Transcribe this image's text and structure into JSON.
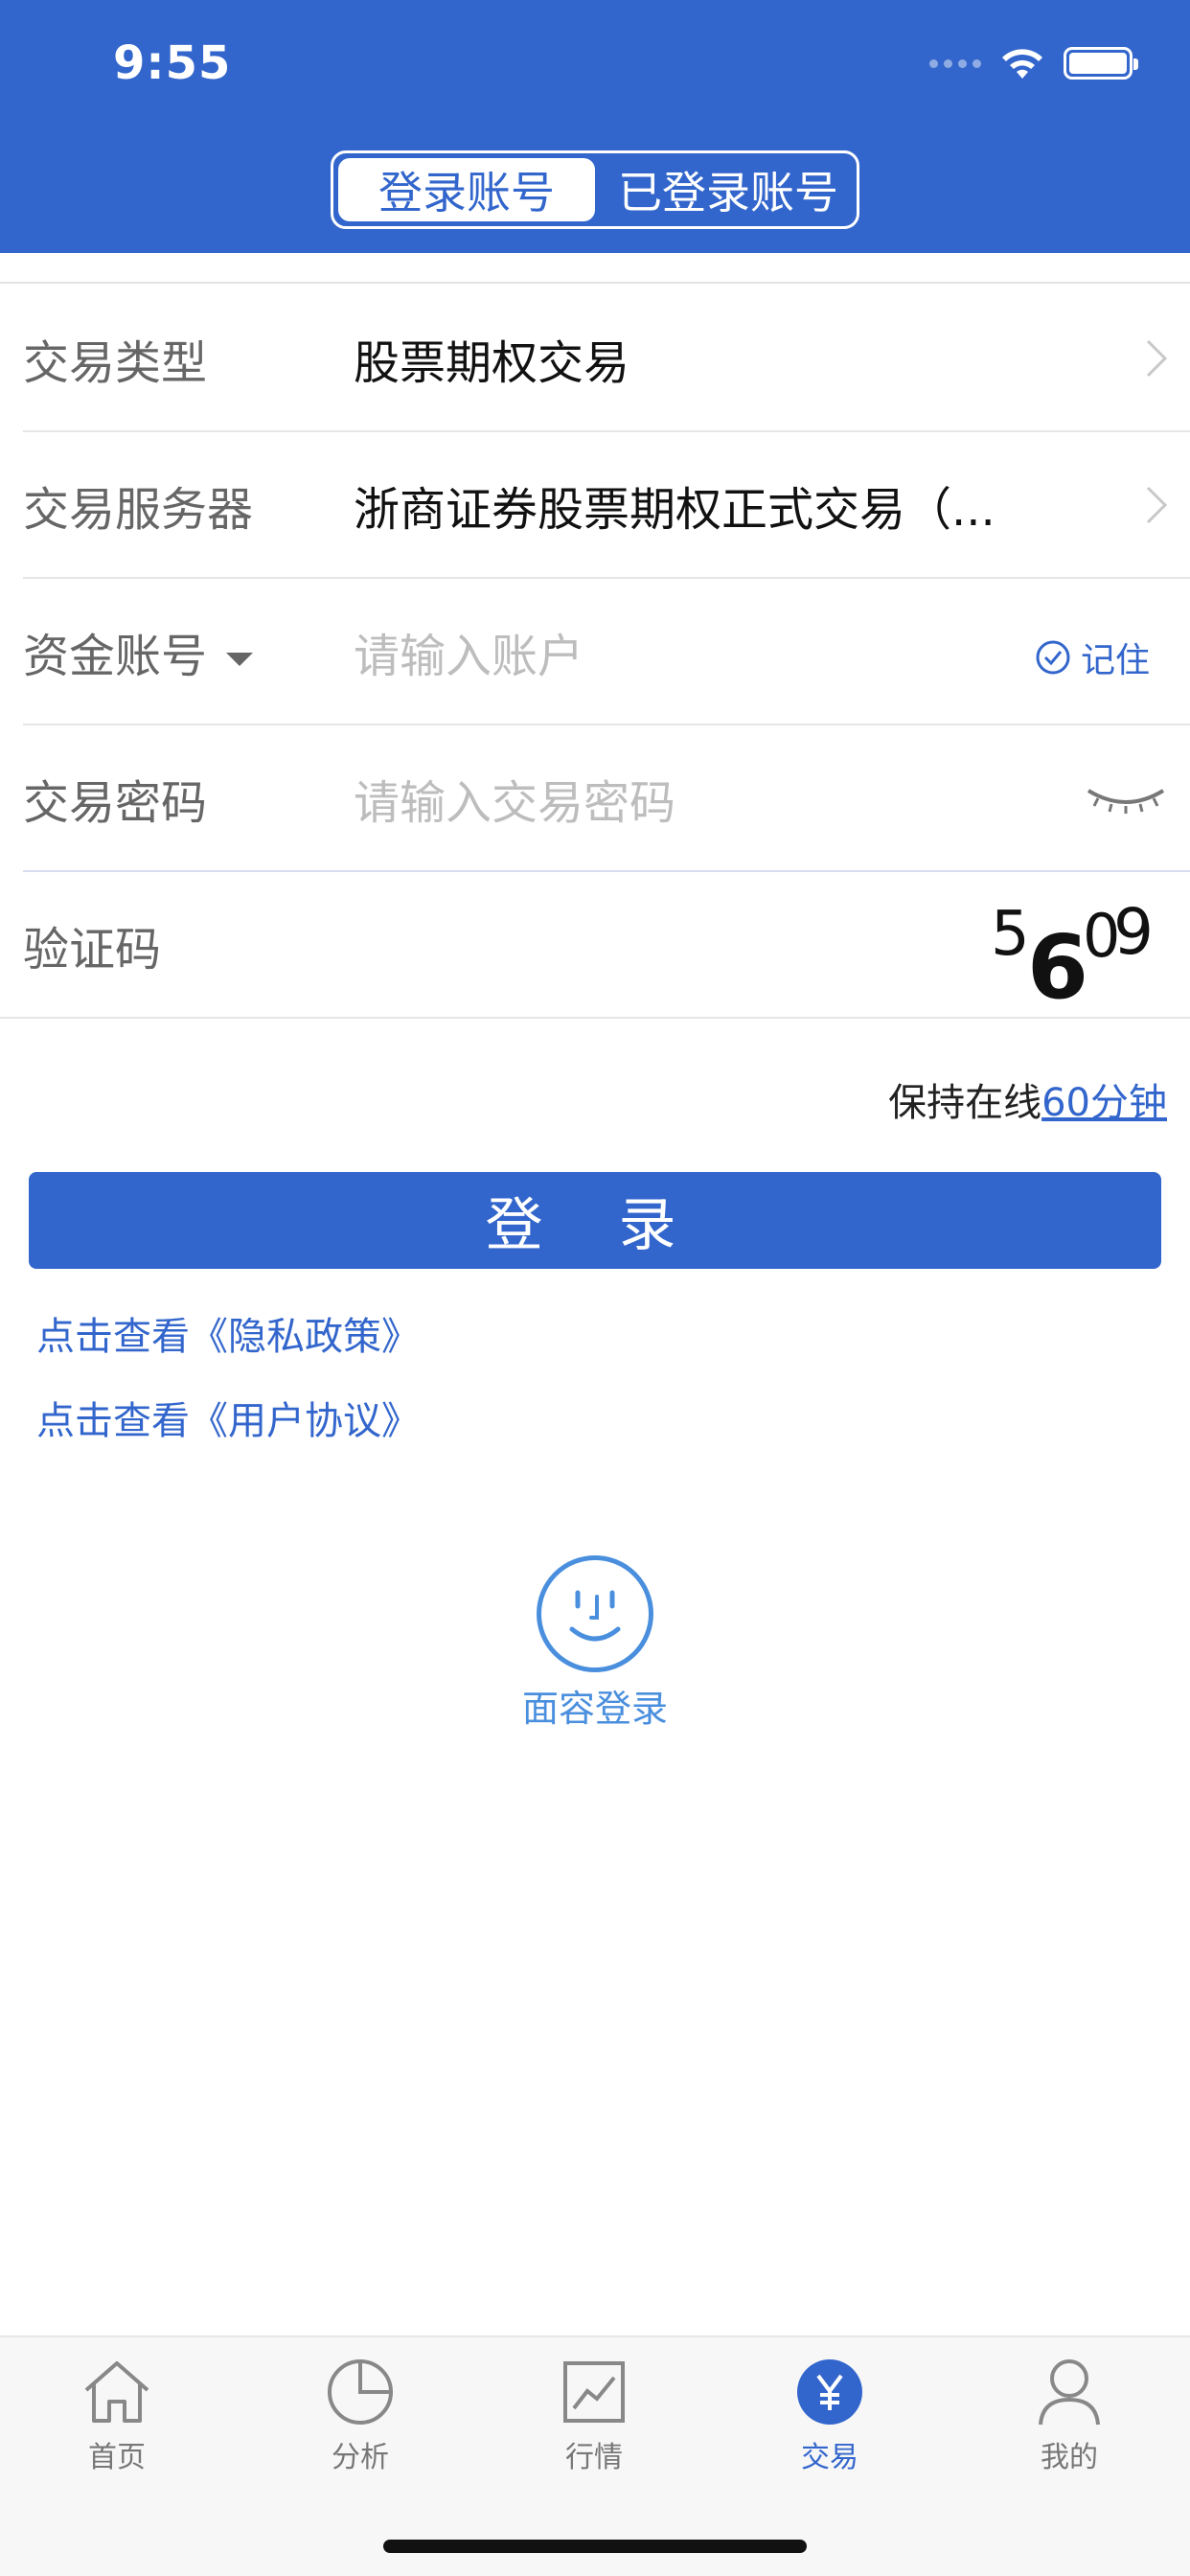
{
  "status": {
    "time": "9:55"
  },
  "header": {
    "tabs": [
      "登录账号",
      "已登录账号"
    ]
  },
  "form": {
    "trade_type": {
      "label": "交易类型",
      "value": "股票期权交易"
    },
    "server": {
      "label": "交易服务器",
      "value": "浙商证券股票期权正式交易（..."
    },
    "account": {
      "label": "资金账号",
      "placeholder": "请输入账户",
      "remember": "记住"
    },
    "password": {
      "label": "交易密码",
      "placeholder": "请输入交易密码"
    },
    "captcha": {
      "label": "验证码",
      "digits": [
        "5",
        "6",
        "0",
        "9"
      ]
    }
  },
  "keep_online": {
    "prefix": "保持在线",
    "link": "60分钟"
  },
  "login_button": "登 录",
  "links": {
    "privacy": "点击查看《隐私政策》",
    "agreement": "点击查看《用户协议》"
  },
  "face_login": "面容登录",
  "tabbar": [
    {
      "label": "首页",
      "icon": "home-icon"
    },
    {
      "label": "分析",
      "icon": "pie-chart-icon"
    },
    {
      "label": "行情",
      "icon": "line-chart-icon"
    },
    {
      "label": "交易",
      "icon": "yen-icon",
      "active": true
    },
    {
      "label": "我的",
      "icon": "person-icon"
    }
  ],
  "colors": {
    "primary": "#3366cc",
    "face": "#4a8fde"
  }
}
